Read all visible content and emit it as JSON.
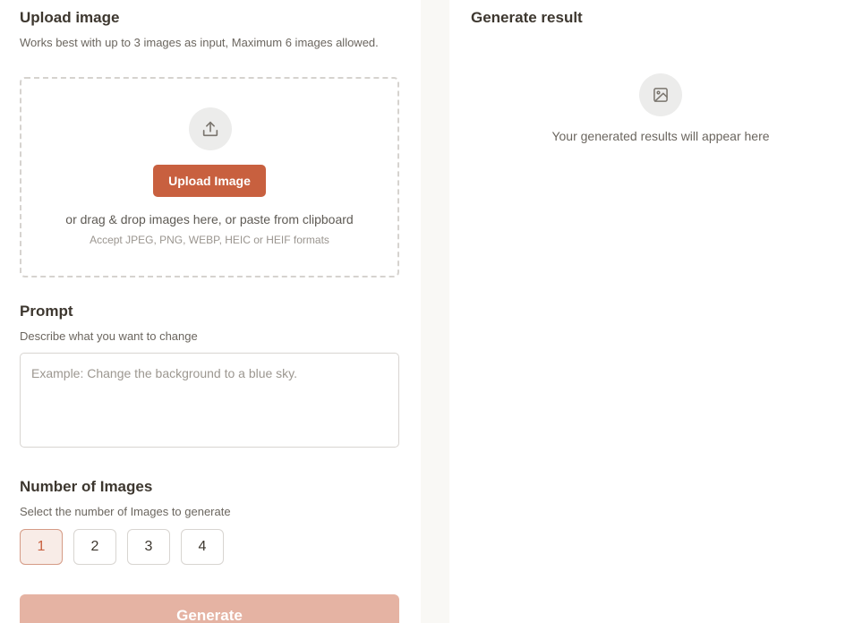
{
  "upload": {
    "title": "Upload image",
    "description": "Works best with up to 3 images as input, Maximum 6 images allowed.",
    "button_label": "Upload Image",
    "drop_hint": "or drag & drop images here, or paste from clipboard",
    "formats_hint": "Accept JPEG, PNG, WEBP, HEIC or HEIF formats",
    "icon": "upload-icon"
  },
  "prompt": {
    "title": "Prompt",
    "description": "Describe what you want to change",
    "value": "",
    "placeholder": "Example: Change the background to a blue sky."
  },
  "number_of_images": {
    "title": "Number of Images",
    "description": "Select the number of Images to generate",
    "options": [
      "1",
      "2",
      "3",
      "4"
    ],
    "selected": "1"
  },
  "generate": {
    "label": "Generate"
  },
  "result": {
    "title": "Generate result",
    "empty_text": "Your generated results will appear here",
    "icon": "image-placeholder-icon"
  },
  "colors": {
    "accent": "#c8603f",
    "accent_disabled": "#e5b3a3",
    "selected_bg": "#f8ece7"
  }
}
